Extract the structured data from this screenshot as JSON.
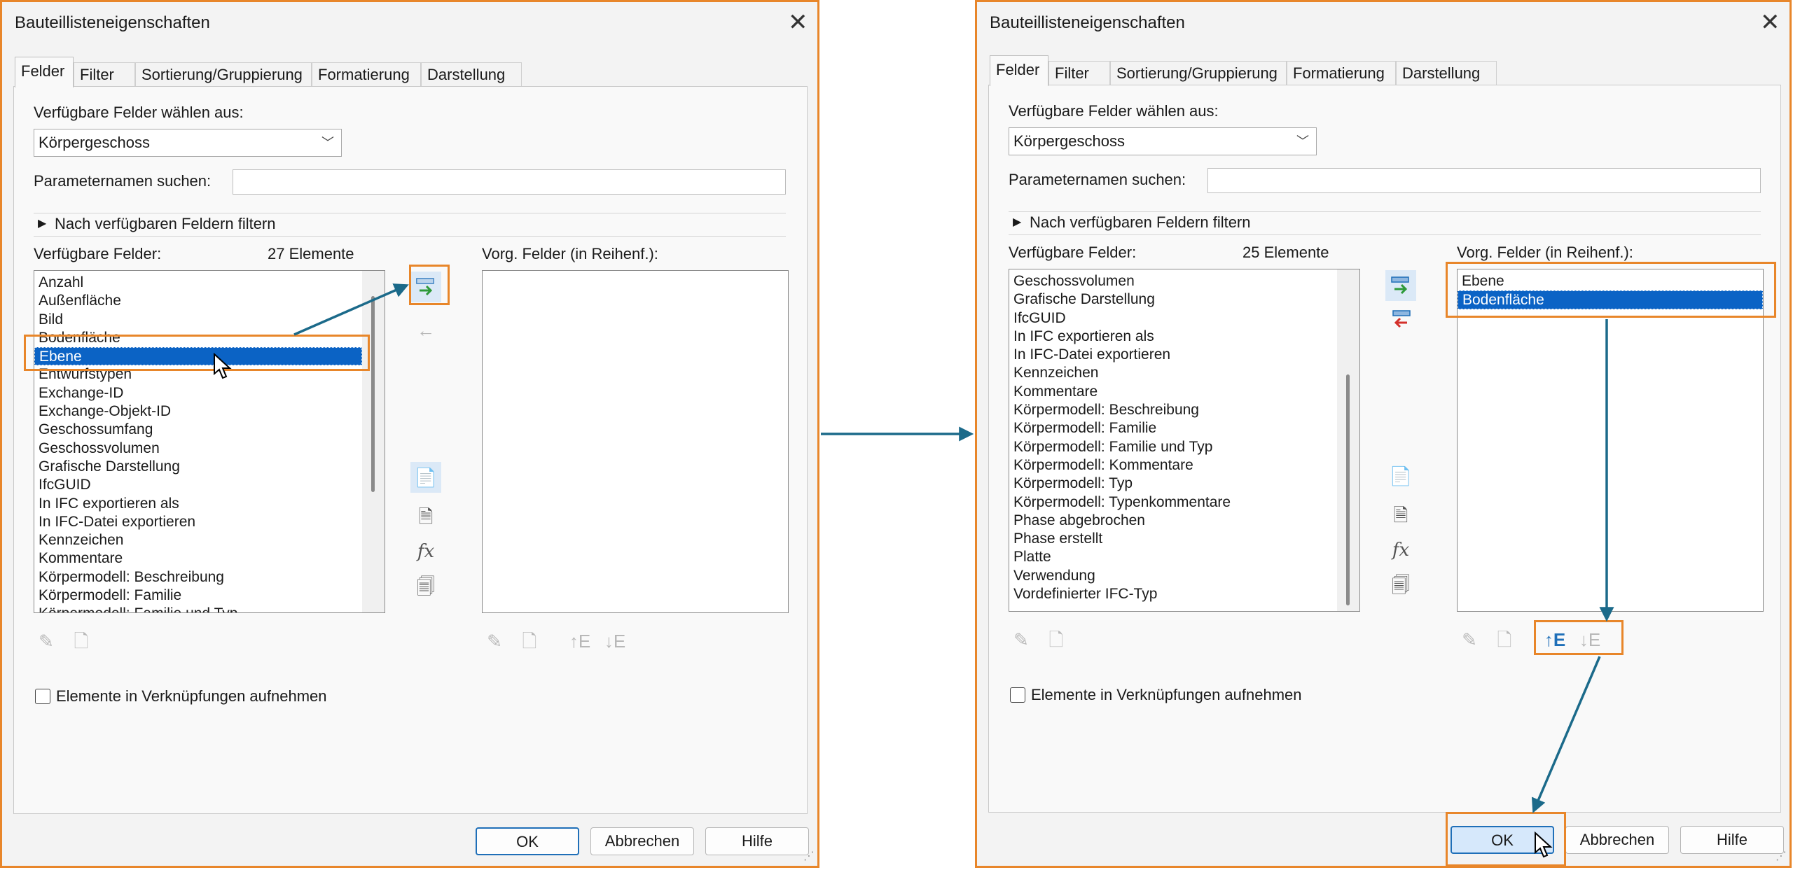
{
  "dialogs": [
    {
      "title": "Bauteillisteneigenschaften",
      "tabs": [
        "Felder",
        "Filter",
        "Sortierung/Gruppierung",
        "Formatierung",
        "Darstellung"
      ],
      "active_tab": "Felder",
      "select_from_label": "Verfügbare Felder wählen aus:",
      "select_from_value": "Körpergeschoss",
      "search_label": "Parameternamen suchen:",
      "search_value": "",
      "filter_expander": "Nach verfügbaren Feldern filtern",
      "available_label": "Verfügbare Felder:",
      "available_count": "27 Elemente",
      "selected_label": "Vorg. Felder (in Reihenf.):",
      "available_items": [
        "Anzahl",
        "Außenfläche",
        "Bild",
        "Bodenfläche",
        "Ebene",
        "Entwurfstypen",
        "Exchange-ID",
        "Exchange-Objekt-ID",
        "Geschossumfang",
        "Geschossvolumen",
        "Grafische Darstellung",
        "IfcGUID",
        "In IFC exportieren als",
        "In IFC-Datei exportieren",
        "Kennzeichen",
        "Kommentare",
        "Körpermodell: Beschreibung",
        "Körpermodell: Familie",
        "Körpermodell: Familie und Typ"
      ],
      "available_selected": "Ebene",
      "selected_items": [],
      "include_links_label": "Elemente in Verknüpfungen aufnehmen",
      "ok": "OK",
      "cancel": "Abbrechen",
      "help": "Hilfe"
    },
    {
      "title": "Bauteillisteneigenschaften",
      "tabs": [
        "Felder",
        "Filter",
        "Sortierung/Gruppierung",
        "Formatierung",
        "Darstellung"
      ],
      "active_tab": "Felder",
      "select_from_label": "Verfügbare Felder wählen aus:",
      "select_from_value": "Körpergeschoss",
      "search_label": "Parameternamen suchen:",
      "search_value": "",
      "filter_expander": "Nach verfügbaren Feldern filtern",
      "available_label": "Verfügbare Felder:",
      "available_count": "25 Elemente",
      "selected_label": "Vorg. Felder (in Reihenf.):",
      "available_items": [
        "Geschossvolumen",
        "Grafische Darstellung",
        "IfcGUID",
        "In IFC exportieren als",
        "In IFC-Datei exportieren",
        "Kennzeichen",
        "Kommentare",
        "Körpermodell: Beschreibung",
        "Körpermodell: Familie",
        "Körpermodell: Familie und Typ",
        "Körpermodell: Kommentare",
        "Körpermodell: Typ",
        "Körpermodell: Typenkommentare",
        "Phase abgebrochen",
        "Phase erstellt",
        "Platte",
        "Verwendung",
        "Vordefinierter IFC-Typ"
      ],
      "selected_items": [
        "Ebene",
        "Bodenfläche"
      ],
      "selected_selected": "Bodenfläche",
      "include_links_label": "Elemente in Verknüpfungen aufnehmen",
      "ok": "OK",
      "cancel": "Abbrechen",
      "help": "Hilfe"
    }
  ],
  "icons": {
    "add": "add-field-icon",
    "remove": "remove-field-icon",
    "new_param": "new-parameter-icon",
    "shared_param": "shared-parameter-icon",
    "formula": "fx-icon",
    "combine": "combine-parameters-icon",
    "edit": "pencil-icon",
    "delete": "delete-parameter-icon",
    "move_up": "move-up-icon",
    "move_down": "move-down-icon"
  },
  "colors": {
    "highlight": "#e8862a",
    "arrow": "#1b6a8a",
    "selection": "#0b63c5"
  }
}
